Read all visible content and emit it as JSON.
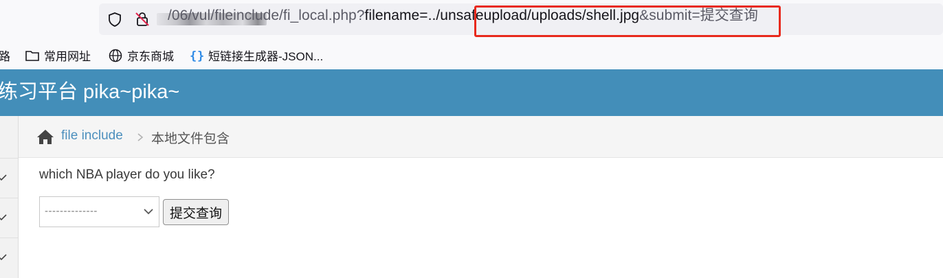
{
  "address_bar": {
    "url_path": "/06/vul/fileinclude/fi_local.php?",
    "url_highlighted": "filename=../unsafeupload/uploads/shell.jpg",
    "url_tail": "&submit=提交查询",
    "highlight_color": "#e8291c"
  },
  "bookmarks": [
    {
      "label": "路",
      "icon": "none"
    },
    {
      "label": "常用网址",
      "icon": "folder-icon"
    },
    {
      "label": "京东商城",
      "icon": "globe-icon"
    },
    {
      "label": "短链接生成器-JSON...",
      "icon": "braces-icon"
    }
  ],
  "header": {
    "title": "练习平台 pika~pika~",
    "background": "#438eb9"
  },
  "breadcrumbs": {
    "link": "file include",
    "current": "本地文件包含"
  },
  "main": {
    "question": "which NBA player do you like?",
    "select_value": "--------------",
    "submit_label": "提交查询"
  },
  "colors": {
    "accent": "#4c8fbd"
  }
}
